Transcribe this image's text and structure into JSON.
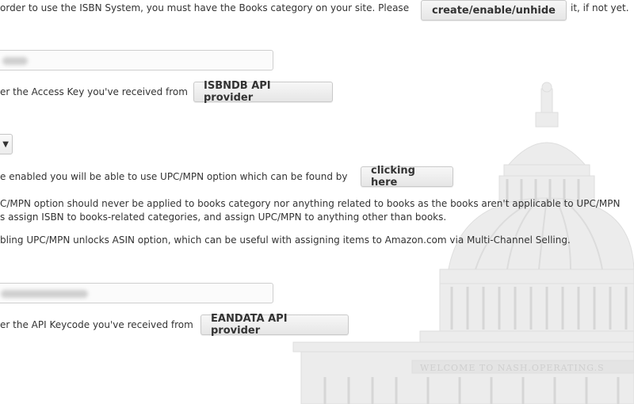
{
  "section1": {
    "text_before": "order to use the ISBN System, you must have the Books category on your site. Please",
    "button": "create/enable/unhide",
    "text_after": "it, if not yet."
  },
  "section2": {
    "access_key_label": "er the Access Key you've received from",
    "button": "ISBNDB API provider"
  },
  "section3": {
    "select_arrow": "▼",
    "text": "e enabled you will be able to use UPC/MPN option which can be found by",
    "button": "clicking here"
  },
  "notes": {
    "line1": "C/MPN option should never be applied to books category nor anything related to books as the books aren't applicable to UPC/MPN",
    "line2": "s assign ISBN to books-related categories, and assign UPC/MPN to anything other than books.",
    "line3": "bling UPC/MPN unlocks ASIN option, which can be useful with assigning items to Amazon.com via Multi-Channel Selling."
  },
  "section4": {
    "api_keycode_label": "er the API Keycode you've received from",
    "button": "EANDATA API provider"
  },
  "background": {
    "banner_text": "WELCOME TO NASH.OPERATING.S"
  },
  "colors": {
    "text": "#333333",
    "button_bg": "#ececec",
    "watermark": "#d9d9d9"
  }
}
